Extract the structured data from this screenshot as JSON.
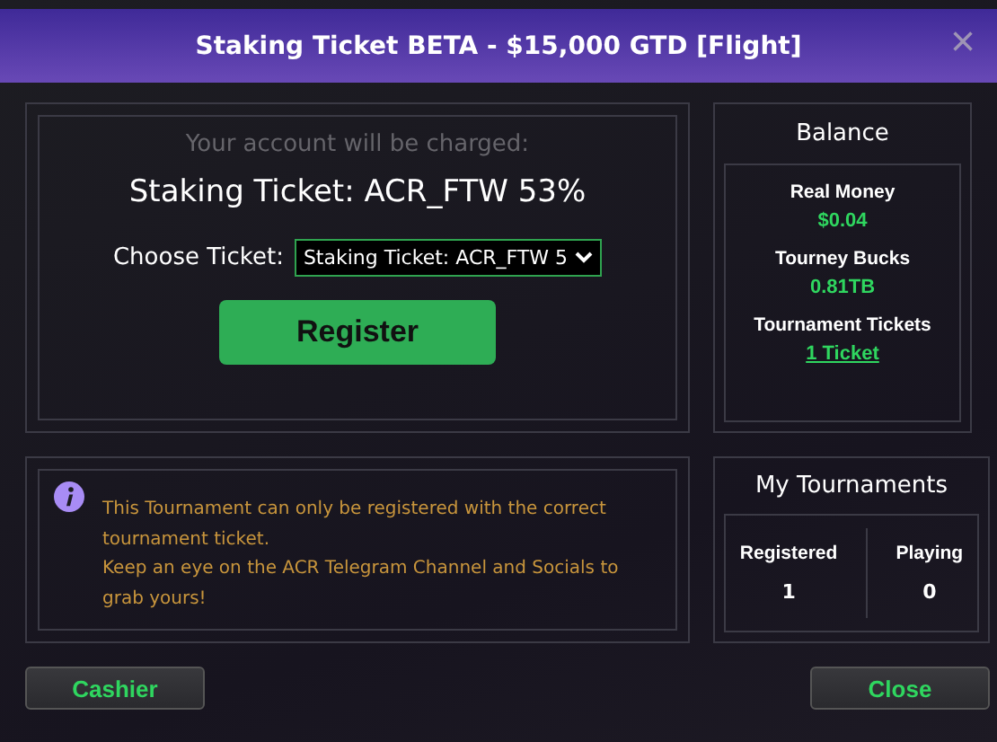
{
  "window": {
    "title": "Staking Ticket BETA - $15,000 GTD [Flight]",
    "close": "×"
  },
  "charge": {
    "caption": "Your account will be charged:",
    "item": "Staking Ticket: ACR_FTW 53%",
    "choose_label": "Choose Ticket:",
    "choose_value": "Staking Ticket: ACR_FTW 5",
    "register": "Register"
  },
  "balance": {
    "title": "Balance",
    "entries": [
      {
        "label": "Real Money",
        "value": "$0.04",
        "kind": "text"
      },
      {
        "label": "Tourney Bucks",
        "value": "0.81TB",
        "kind": "text"
      },
      {
        "label": "Tournament Tickets",
        "value": "1 Ticket",
        "kind": "link"
      }
    ]
  },
  "notice": [
    "This Tournament can only be registered with the correct tournament ticket.",
    "Keep an eye on the ACR Telegram Channel and Socials to grab yours!"
  ],
  "my_tournaments": {
    "title": "My Tournaments",
    "stats": [
      {
        "label": "Registered",
        "value": "1"
      },
      {
        "label": "Playing",
        "value": "0"
      }
    ]
  },
  "buttons": [
    "Cashier",
    "Close"
  ]
}
